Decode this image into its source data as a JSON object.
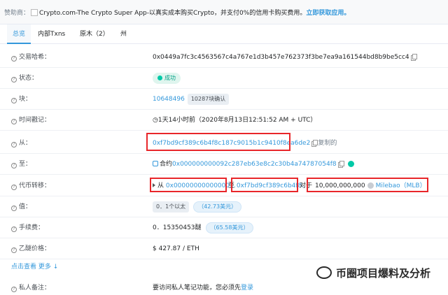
{
  "sponsor": {
    "label": "赞助商：",
    "title": "Crypto.com-The Crypto Super App",
    "text": "-以真实成本购买Crypto，并支付0%的信用卡购买费用。",
    "cta": "立即获取应用。"
  },
  "tabs": [
    {
      "label": "总览",
      "active": true
    },
    {
      "label": "内部Txns"
    },
    {
      "label": "原木（2）"
    },
    {
      "label": "州"
    }
  ],
  "rows": {
    "hash": {
      "label": "交易哈希：",
      "value": "0x0449a7fc3c4563567c4a767e1d3b457e762373f3be7ea9a161544bd8b9be5cc4"
    },
    "status": {
      "label": "状态：",
      "value": "成功"
    },
    "block": {
      "label": "块：",
      "value": "10648496",
      "confirm": "10287块确认"
    },
    "time": {
      "label": "时间戳记：",
      "value": "1天14小时前（2020年8月13日12:51:52 AM + UTC）"
    },
    "from": {
      "label": "从：",
      "value": "0xf7bd9cf389c6b4f8c187c9015b1c9410f8ea6de2",
      "copied": "复制的"
    },
    "to": {
      "label": "至：",
      "prefix": "合约",
      "value": "0x000000000092c287eb63e8c2c30b4a74787054f8"
    },
    "transfer": {
      "label": "代币转移：",
      "from_prefix": "从",
      "from_value": "0x00000000000000...",
      "to_prefix": "至",
      "to_value": "0xf7bd9cf389c6b4f8...",
      "for_prefix": "对于",
      "amount": "10,000,000,000",
      "token": "Milebao（MLB）"
    },
    "value": {
      "label": "值：",
      "value": "0．1个以太",
      "usd": "（42.73美元）"
    },
    "fee": {
      "label": "手续费：",
      "value": "0．15350453醚",
      "usd": "（65.58美元）"
    },
    "gas": {
      "label": "乙醚价格：",
      "value": "$ 427.87 / ETH"
    },
    "note": {
      "label": "私人备注：",
      "value": "要访问私人笔记功能，您必须先",
      "link": "登录"
    }
  },
  "more": "点击查看 更多 ↓",
  "watermark": "币圈项目爆料及分析",
  "colors": {
    "accent": "#3498db",
    "success": "#00c9a7",
    "highlight": "#e8262a"
  }
}
